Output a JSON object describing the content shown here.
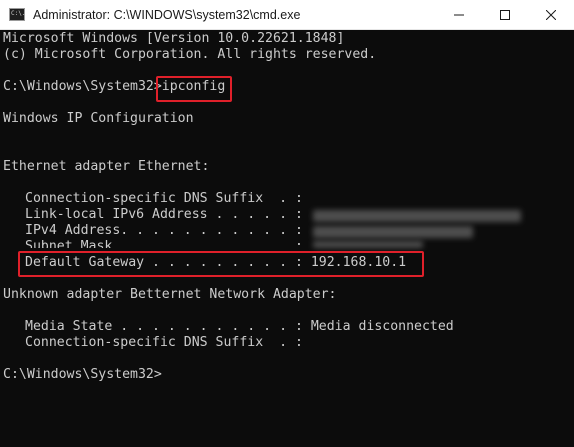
{
  "window": {
    "title": "Administrator: C:\\WINDOWS\\system32\\cmd.exe",
    "app_icon_glyph": "C:\\."
  },
  "console": {
    "lines": [
      "Microsoft Windows [Version 10.0.22621.1848]",
      "(c) Microsoft Corporation. All rights reserved.",
      "",
      "C:\\Windows\\System32>",
      "",
      "Windows IP Configuration",
      "",
      "",
      "Ethernet adapter Ethernet:",
      "",
      "Connection-specific DNS Suffix  . :",
      "Link-local IPv6 Address . . . . . :",
      "IPv4 Address. . . . . . . . . . . :",
      "Subnet Mask . . . . . . . . . . . :",
      "Default Gateway . . . . . . . . . : 192.168.10.1",
      "",
      "Unknown adapter Betternet Network Adapter:",
      "",
      "Media State . . . . . . . . . . . : Media disconnected",
      "Connection-specific DNS Suffix  . :",
      "",
      "C:\\Windows\\System32>"
    ],
    "command": "ipconfig"
  },
  "colors": {
    "console_bg": "#0c0c0c",
    "console_text": "#cccccc",
    "highlight": "#e0202a",
    "titlebar_bg": "#ffffff"
  },
  "icons": {
    "minimize": "minimize-icon",
    "maximize": "maximize-icon",
    "close": "close-icon"
  }
}
